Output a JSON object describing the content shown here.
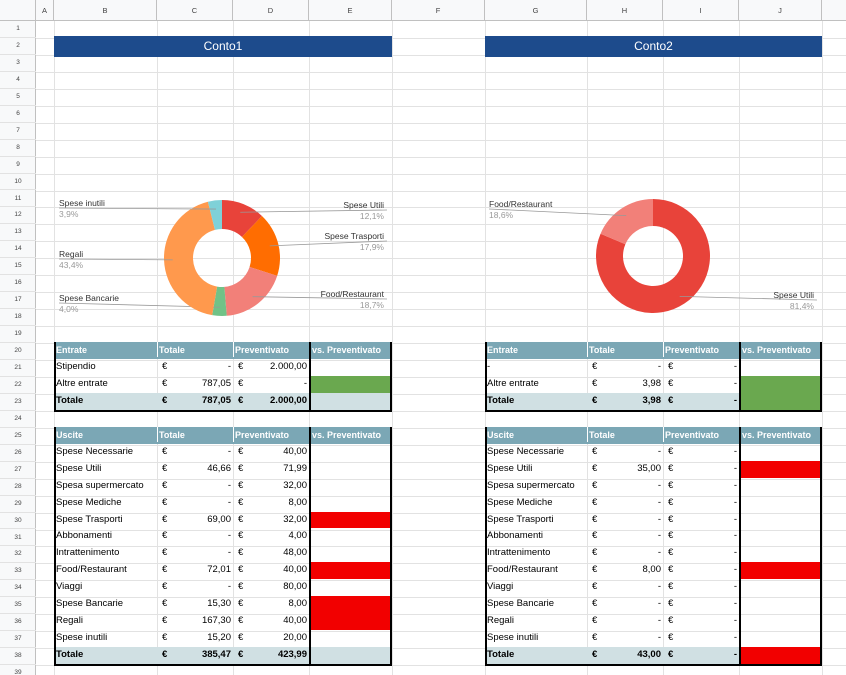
{
  "columns": [
    "A",
    "B",
    "C",
    "D",
    "E",
    "F",
    "G",
    "H",
    "I",
    "J"
  ],
  "rows": [
    "1",
    "2",
    "3",
    "4",
    "5",
    "6",
    "7",
    "8",
    "9",
    "10",
    "11",
    "12",
    "13",
    "14",
    "15",
    "16",
    "17",
    "18",
    "19",
    "20",
    "21",
    "22",
    "23",
    "24",
    "25",
    "26",
    "27",
    "28",
    "29",
    "30",
    "31",
    "32",
    "33",
    "34",
    "35",
    "36",
    "37",
    "38",
    "39"
  ],
  "colors": {
    "banner": "#1d4b8c",
    "header": "#7ba7b5",
    "total": "#d0e0e3",
    "over_budget": "#f20000",
    "ok": "#6aa84f"
  },
  "conto1": {
    "title": "Conto1",
    "chart_data": {
      "type": "pie",
      "slices": [
        {
          "name": "Spese Utili",
          "pct": "12,1%",
          "value": 12.1,
          "color": "#e8433a"
        },
        {
          "name": "Spese Trasporti",
          "pct": "17,9%",
          "value": 17.9,
          "color": "#ff6d01"
        },
        {
          "name": "Food/Restaurant",
          "pct": "18,7%",
          "value": 18.7,
          "color": "#f28079"
        },
        {
          "name": "Spese Bancarie",
          "pct": "4,0%",
          "value": 4.0,
          "color": "#71c287"
        },
        {
          "name": "Regali",
          "pct": "43,4%",
          "value": 43.4,
          "color": "#ff994d"
        },
        {
          "name": "Spese inutili",
          "pct": "3,9%",
          "value": 3.9,
          "color": "#7fd1d8"
        }
      ]
    },
    "entrate": {
      "header": [
        "Entrate",
        "Totale",
        "Preventivato",
        "vs. Preventivato"
      ],
      "rows": [
        {
          "label": "Stipendio",
          "cur1": "€",
          "tot": "-",
          "cur2": "€",
          "prev": "2.000,00",
          "status": "none"
        },
        {
          "label": "Altre entrate",
          "cur1": "€",
          "tot": "787,05",
          "cur2": "€",
          "prev": "-",
          "status": "green"
        }
      ],
      "total": {
        "label": "Totale",
        "cur1": "€",
        "tot": "787,05",
        "cur2": "€",
        "prev": "2.000,00",
        "status": "none"
      }
    },
    "uscite": {
      "header": [
        "Uscite",
        "Totale",
        "Preventivato",
        "vs. Preventivato"
      ],
      "rows": [
        {
          "label": "Spese Necessarie",
          "cur1": "€",
          "tot": "-",
          "cur2": "€",
          "prev": "40,00",
          "status": "none"
        },
        {
          "label": "Spese Utili",
          "cur1": "€",
          "tot": "46,66",
          "cur2": "€",
          "prev": "71,99",
          "status": "none"
        },
        {
          "label": "Spesa supermercato",
          "cur1": "€",
          "tot": "-",
          "cur2": "€",
          "prev": "32,00",
          "status": "none"
        },
        {
          "label": "Spese Mediche",
          "cur1": "€",
          "tot": "-",
          "cur2": "€",
          "prev": "8,00",
          "status": "none"
        },
        {
          "label": "Spese Trasporti",
          "cur1": "€",
          "tot": "69,00",
          "cur2": "€",
          "prev": "32,00",
          "status": "red"
        },
        {
          "label": "Abbonamenti",
          "cur1": "€",
          "tot": "-",
          "cur2": "€",
          "prev": "4,00",
          "status": "none"
        },
        {
          "label": "Intrattenimento",
          "cur1": "€",
          "tot": "-",
          "cur2": "€",
          "prev": "48,00",
          "status": "none"
        },
        {
          "label": "Food/Restaurant",
          "cur1": "€",
          "tot": "72,01",
          "cur2": "€",
          "prev": "40,00",
          "status": "red"
        },
        {
          "label": "Viaggi",
          "cur1": "€",
          "tot": "-",
          "cur2": "€",
          "prev": "80,00",
          "status": "none"
        },
        {
          "label": "Spese Bancarie",
          "cur1": "€",
          "tot": "15,30",
          "cur2": "€",
          "prev": "8,00",
          "status": "red"
        },
        {
          "label": "Regali",
          "cur1": "€",
          "tot": "167,30",
          "cur2": "€",
          "prev": "40,00",
          "status": "red"
        },
        {
          "label": "Spese inutili",
          "cur1": "€",
          "tot": "15,20",
          "cur2": "€",
          "prev": "20,00",
          "status": "none"
        }
      ],
      "total": {
        "label": "Totale",
        "cur1": "€",
        "tot": "385,47",
        "cur2": "€",
        "prev": "423,99",
        "status": "none"
      }
    }
  },
  "conto2": {
    "title": "Conto2",
    "chart_data": {
      "type": "pie",
      "slices": [
        {
          "name": "Spese Utili",
          "pct": "81,4%",
          "value": 81.4,
          "color": "#e8433a"
        },
        {
          "name": "Food/Restaurant",
          "pct": "18,6%",
          "value": 18.6,
          "color": "#f28079"
        }
      ]
    },
    "entrate": {
      "header": [
        "Entrate",
        "Totale",
        "Preventivato",
        "vs. Preventivato"
      ],
      "rows": [
        {
          "label": "-",
          "cur1": "€",
          "tot": "-",
          "cur2": "€",
          "prev": "-",
          "status": "none"
        },
        {
          "label": "Altre entrate",
          "cur1": "€",
          "tot": "3,98",
          "cur2": "€",
          "prev": "-",
          "status": "green"
        }
      ],
      "total": {
        "label": "Totale",
        "cur1": "€",
        "tot": "3,98",
        "cur2": "€",
        "prev": "-",
        "status": "green"
      }
    },
    "uscite": {
      "header": [
        "Uscite",
        "Totale",
        "Preventivato",
        "vs. Preventivato"
      ],
      "rows": [
        {
          "label": "Spese Necessarie",
          "cur1": "€",
          "tot": "-",
          "cur2": "€",
          "prev": "-",
          "status": "none"
        },
        {
          "label": "Spese Utili",
          "cur1": "€",
          "tot": "35,00",
          "cur2": "€",
          "prev": "-",
          "status": "red"
        },
        {
          "label": "Spesa supermercato",
          "cur1": "€",
          "tot": "-",
          "cur2": "€",
          "prev": "-",
          "status": "none"
        },
        {
          "label": "Spese Mediche",
          "cur1": "€",
          "tot": "-",
          "cur2": "€",
          "prev": "-",
          "status": "none"
        },
        {
          "label": "Spese Trasporti",
          "cur1": "€",
          "tot": "-",
          "cur2": "€",
          "prev": "-",
          "status": "none"
        },
        {
          "label": "Abbonamenti",
          "cur1": "€",
          "tot": "-",
          "cur2": "€",
          "prev": "-",
          "status": "none"
        },
        {
          "label": "Intrattenimento",
          "cur1": "€",
          "tot": "-",
          "cur2": "€",
          "prev": "-",
          "status": "none"
        },
        {
          "label": "Food/Restaurant",
          "cur1": "€",
          "tot": "8,00",
          "cur2": "€",
          "prev": "-",
          "status": "red"
        },
        {
          "label": "Viaggi",
          "cur1": "€",
          "tot": "-",
          "cur2": "€",
          "prev": "-",
          "status": "none"
        },
        {
          "label": "Spese Bancarie",
          "cur1": "€",
          "tot": "-",
          "cur2": "€",
          "prev": "-",
          "status": "none"
        },
        {
          "label": "Regali",
          "cur1": "€",
          "tot": "-",
          "cur2": "€",
          "prev": "-",
          "status": "none"
        },
        {
          "label": "Spese inutili",
          "cur1": "€",
          "tot": "-",
          "cur2": "€",
          "prev": "-",
          "status": "none"
        }
      ],
      "total": {
        "label": "Totale",
        "cur1": "€",
        "tot": "43,00",
        "cur2": "€",
        "prev": "-",
        "status": "red"
      }
    }
  }
}
